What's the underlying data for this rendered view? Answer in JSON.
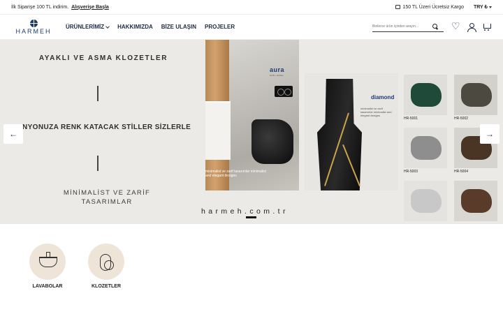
{
  "topbar": {
    "promo": "İlk Siparişe 100 TL indirim.",
    "promo_link": "Alışverişe Başla",
    "cargo": "150 TL Üzeri Ücretsiz Kargo",
    "currency": "TRY ₺"
  },
  "header": {
    "logo": "HARMEH",
    "nav": [
      "ÜRÜNLERİMİZ",
      "HAKKIMIZDA",
      "BİZE ULAŞIN",
      "PROJELER"
    ],
    "search_placeholder": "Binlerce ürün içinden arayın..."
  },
  "hero": {
    "heading_top": "AYAKLI VE ASMA KLOZETLER",
    "heading_mid": "BANYONUZA RENK KATACAK STİLLER SİZLERLE",
    "heading_bottom": "MİNİMALİST VE ZARİF TASARIMLAR",
    "aura_brand": "aura",
    "aura_sub": "seribi • seribes",
    "aura_caption": "minimalist ve zarif tasarımlar minimalist and elegant designs",
    "diamond_brand": "diamond",
    "diamond_text": "minimalist ve zarif tasarımlar minimalist and elegant designs",
    "tiles": [
      {
        "code": "HR-5001",
        "color": "#1f4a3a"
      },
      {
        "code": "HR-5002",
        "color": "#4c4a40"
      },
      {
        "code": "HR-5003",
        "color": "#8e8e8e"
      },
      {
        "code": "HR-5004",
        "color": "#4a3525"
      },
      {
        "code": "",
        "color": "#c8c8c8"
      },
      {
        "code": "",
        "color": "#5a3a28"
      }
    ],
    "url": "harmeh.com.tr"
  },
  "categories": [
    {
      "label": "LAVABOLAR",
      "icon": "sink-icon"
    },
    {
      "label": "KLOZETLER",
      "icon": "toilet-icon"
    }
  ]
}
